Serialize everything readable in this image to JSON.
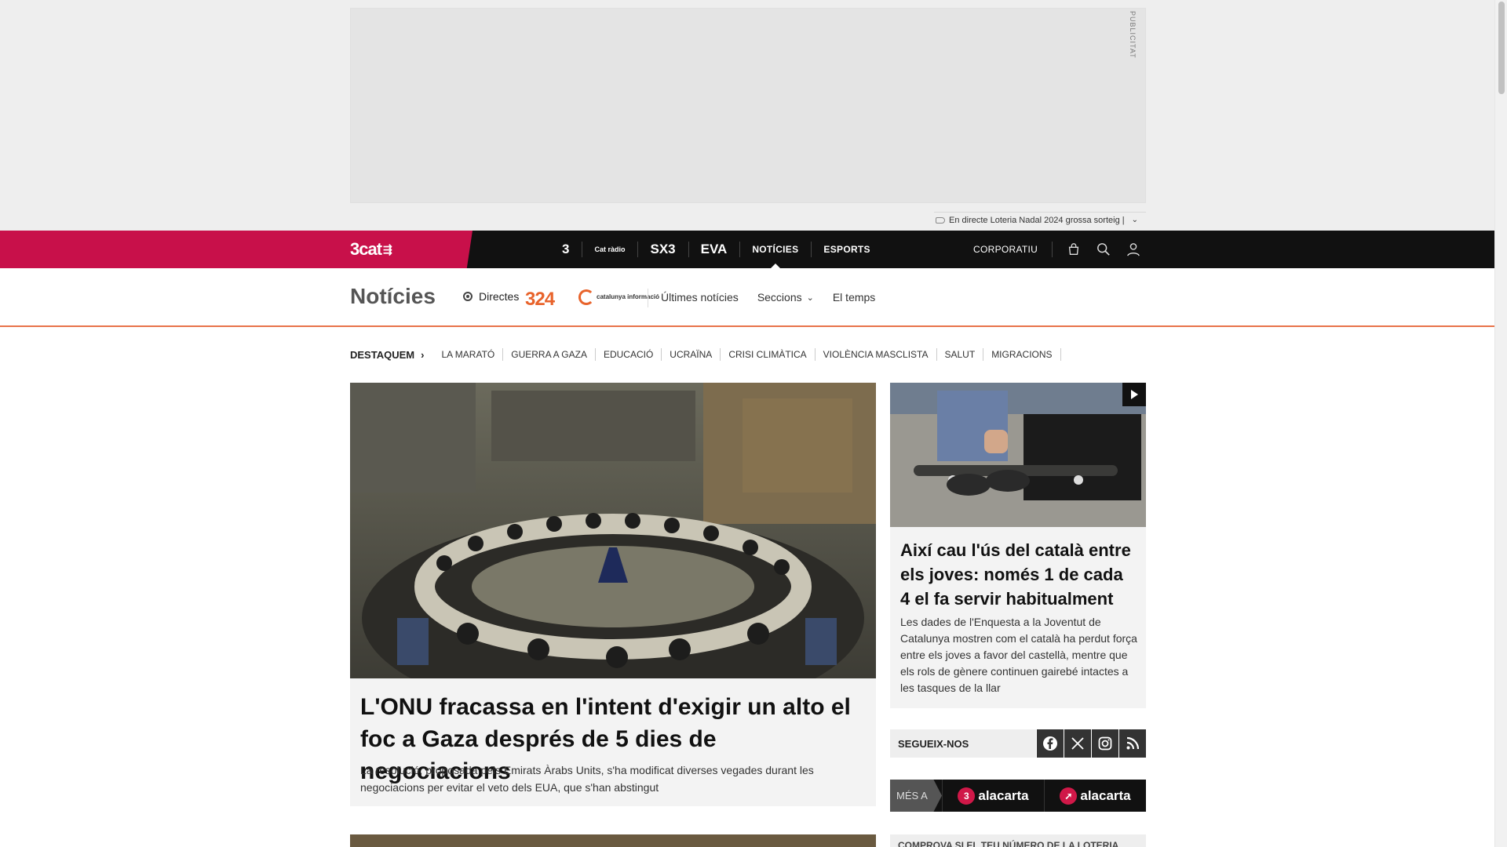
{
  "ad": {
    "label": "PUBLICITAT"
  },
  "ticker": {
    "text": "En directe Loteria Nadal 2024 grossa sorteig |"
  },
  "nav": {
    "brand": "3cat",
    "channels": [
      {
        "label": "3"
      },
      {
        "label": "Cat ràdio"
      },
      {
        "label": "SX3"
      },
      {
        "label": "EVA"
      },
      {
        "label": "NOTÍCIES"
      },
      {
        "label": "ESPORTS"
      }
    ],
    "corporatiu": "CORPORATIU"
  },
  "section": {
    "title": "Notícies",
    "directes": "Directes",
    "logo_324": "324",
    "logo_ci": "catalunya informació",
    "links": {
      "ultimes": "Últimes notícies",
      "seccions": "Seccions",
      "temps": "El temps"
    }
  },
  "destaquem": {
    "lead": "DESTAQUEM",
    "items": [
      "LA MARATÓ",
      "GUERRA A GAZA",
      "EDUCACIÓ",
      "UCRAÏNA",
      "CRISI CLIMÀTICA",
      "VIOLÈNCIA MASCLISTA",
      "SALUT",
      "MIGRACIONS"
    ]
  },
  "main_story": {
    "headline": "L'ONU fracassa en l'intent d'exigir un alto el foc a Gaza després de 5 dies de negociacions",
    "summary": "La resolució, proposada pels Emirats Àrabs Units, s'ha modificat diverses vegades durant les negociacions per evitar el veto dels EUA, que s'han abstingut"
  },
  "side_story": {
    "headline": "Així cau l'ús del català entre els joves: només 1 de cada 4 el fa servir habitualment",
    "summary": "Les dades de l'Enquesta a la Joventut de Catalunya mostren com el català ha perdut força entre els joves a favor del castellà, mentre que els rols de gènere continuen gairebé intactes a les tasques de la llar"
  },
  "follow": {
    "label": "SEGUEIX-NOS",
    "icons": [
      "facebook-icon",
      "x-icon",
      "instagram-icon",
      "rss-icon"
    ]
  },
  "alacarta": {
    "mes": "MÉS A",
    "items": [
      {
        "badge": "3",
        "label": "alacarta"
      },
      {
        "label": "alacarta"
      }
    ]
  },
  "next_right": {
    "text": "COMPROVA SI EL TEU NÚMERO DE LA LOTERIA"
  },
  "colors": {
    "brand": "#c8104a",
    "nav_bg": "#111111",
    "accent": "#e8734a"
  }
}
